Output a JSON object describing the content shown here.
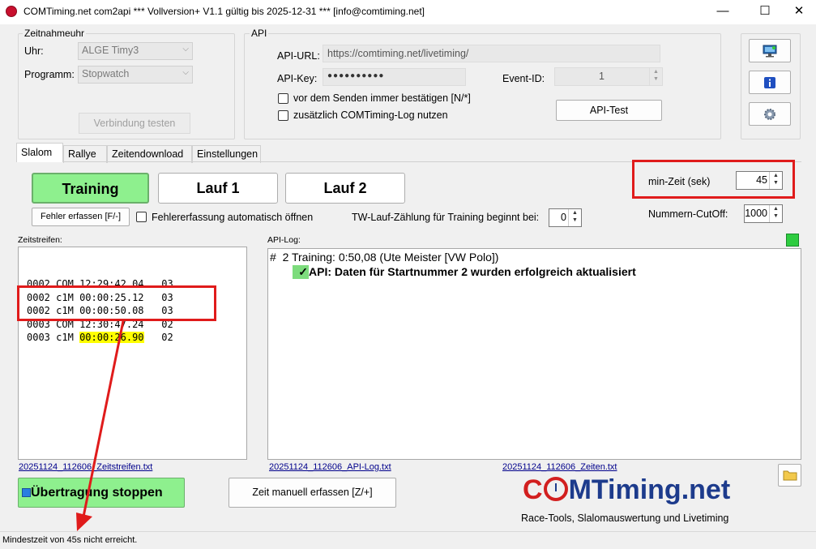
{
  "window": {
    "title": "COMTiming.net com2api *** Vollversion+ V1.1 gültig bis 2025-12-31 *** [info@comtiming.net]",
    "minimize": "—",
    "maximize": "☐",
    "close": "✕"
  },
  "zeitnahmeuhr": {
    "group_label": "Zeitnahmeuhr",
    "uhr_label": "Uhr:",
    "uhr_value": "ALGE Timy3",
    "programm_label": "Programm:",
    "programm_value": "Stopwatch",
    "test_button": "Verbindung testen"
  },
  "api": {
    "group_label": "API",
    "url_label": "API-URL:",
    "url_value": "https://comtiming.net/livetiming/",
    "key_label": "API-Key:",
    "key_value": "●●●●●●●●●●",
    "event_label": "Event-ID:",
    "event_value": "1",
    "confirm_label": "vor dem Senden immer bestätigen [N/*]",
    "log_label": "zusätzlich COMTiming-Log nutzen",
    "test_button": "API-Test"
  },
  "tabs": [
    "Slalom",
    "Rallye",
    "Zeitendownload",
    "Einstellungen"
  ],
  "slalom": {
    "training_button": "Training",
    "lauf1_button": "Lauf 1",
    "lauf2_button": "Lauf 2",
    "fehler_button": "Fehler erfassen [F/-]",
    "auto_fehler_label": "Fehlererfassung automatisch öffnen",
    "tw_label": "TW-Lauf-Zählung für Training beginnt bei:",
    "tw_value": "0",
    "minzeit_label": "min-Zeit (sek)",
    "minzeit_value": "45",
    "cutoff_label": "Nummern-CutOff:",
    "cutoff_value": "1000"
  },
  "zeitstreifen": {
    "label": "Zeitstreifen:",
    "lines": [
      {
        "num": "0002",
        "type": "COM",
        "time": "12:29:42.04",
        "ch": "03"
      },
      {
        "num": "0002",
        "type": "c1M",
        "time": "00:00:25.12",
        "ch": "03"
      },
      {
        "num": "0002",
        "type": "c1M",
        "time": "00:00:50.08",
        "ch": "03"
      },
      {
        "num": "0003",
        "type": "COM",
        "time": "12:30:47.24",
        "ch": "02"
      },
      {
        "num": "0003",
        "type": "c1M",
        "time": "00:00:26.90",
        "ch": "02"
      }
    ],
    "file_link": "20251124_112606_Zeitstreifen.txt"
  },
  "apilog": {
    "label": "API-Log:",
    "line1": "#  2 Training: 0:50,08 (Ute Meister [VW Polo])",
    "line2_check": "✓",
    "line2": "API: Daten für Startnummer 2 wurden erfolgreich aktualisiert",
    "file_link": "20251124_112606_API-Log.txt",
    "zeiten_link": "20251124_112606_Zeiten.txt"
  },
  "bottom": {
    "stop_button": "Übertragung stoppen",
    "manual_button": "Zeit manuell erfassen [Z/+]",
    "logo_text_1": "C",
    "logo_text_2": "MTiming.net",
    "tagline": "Race-Tools, Slalomauswertung und Livetiming"
  },
  "status": {
    "text": "Mindestzeit von 45s nicht erreicht."
  },
  "icons": {
    "monitor": "monitor-icon",
    "info": "info-icon",
    "settings": "gear-icon",
    "folder": "folder-icon"
  },
  "colors": {
    "training_green": "#8ef08e",
    "highlight_yellow": "#ffff00",
    "annotation_red": "#e01b1b",
    "status_green": "#2ecc40",
    "logo_red": "#d21f1f",
    "logo_blue": "#1d3b8c"
  }
}
